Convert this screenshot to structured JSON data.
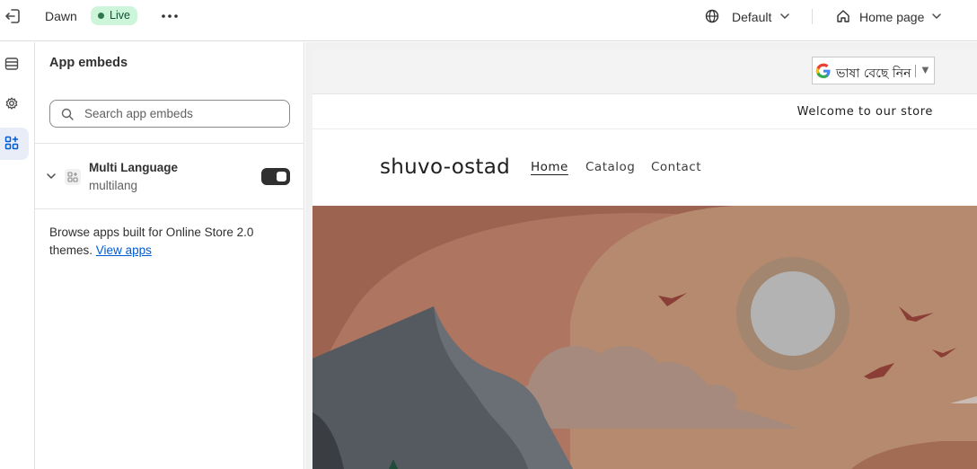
{
  "topbar": {
    "theme_name": "Dawn",
    "status_badge": "Live",
    "view_selector": "Default",
    "page_selector": "Home page"
  },
  "sidebar": {
    "items": [
      {
        "name": "sections",
        "icon": "sections-icon"
      },
      {
        "name": "theme-settings",
        "icon": "gear-icon"
      },
      {
        "name": "app-embeds",
        "icon": "apps-icon",
        "active": true
      }
    ]
  },
  "panel": {
    "title": "App embeds",
    "search_placeholder": "Search app embeds",
    "embeds": [
      {
        "name": "Multi Language",
        "app": "multilang",
        "enabled": true
      }
    ],
    "browse_text": "Browse apps built for Online Store 2.0 themes.",
    "browse_link": "View apps"
  },
  "preview": {
    "translate_widget": "ভাষা বেছে নিন",
    "translate_arrow": "▼",
    "announcement": "Welcome to our store",
    "store_name": "shuvo-ostad",
    "nav": [
      "Home",
      "Catalog",
      "Contact"
    ],
    "active_nav": "Home"
  },
  "colors": {
    "accent": "#005bd3",
    "live_badge_bg": "#cdf5d9",
    "live_badge_dot": "#2c7a4b",
    "toggle_on": "#303030",
    "hero_bg": "#9c6450",
    "hero_sun": "#b3b3b3"
  }
}
